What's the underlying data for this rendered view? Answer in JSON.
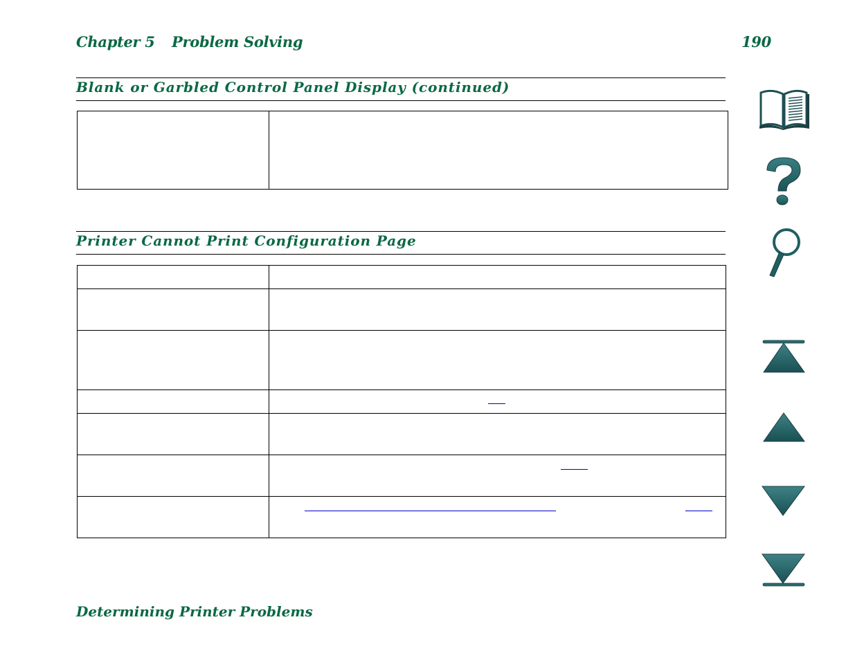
{
  "header": {
    "chapter": "Chapter 5",
    "chapter_title": "Problem Solving",
    "page_number": "190"
  },
  "sections": [
    {
      "title": "Blank or Garbled Control Panel Display (continued)",
      "rows": [
        {
          "cause": "",
          "solution": ""
        }
      ]
    },
    {
      "title": "Printer Cannot Print Configuration Page",
      "rows": [
        {
          "cause": "",
          "solution": ""
        },
        {
          "cause": "",
          "solution": ""
        },
        {
          "cause": "",
          "solution": ""
        },
        {
          "cause": "",
          "solution": "",
          "links": [
            ""
          ]
        },
        {
          "cause": "",
          "solution": ""
        },
        {
          "cause": "",
          "solution": "",
          "links": [
            ""
          ]
        },
        {
          "cause": "",
          "solution": "",
          "links": [
            "",
            ""
          ]
        }
      ]
    }
  ],
  "footer": {
    "section_name": "Determining Printer Problems"
  },
  "nav_icons": [
    {
      "name": "contents-book-icon"
    },
    {
      "name": "help-question-icon"
    },
    {
      "name": "search-magnifier-icon"
    },
    {
      "name": "first-page-icon"
    },
    {
      "name": "previous-page-icon"
    },
    {
      "name": "next-page-icon"
    },
    {
      "name": "last-page-icon"
    }
  ],
  "colors": {
    "heading_green": "#0b6845",
    "icon_teal": "#1f5f62",
    "link_blue": "#0000cc"
  }
}
